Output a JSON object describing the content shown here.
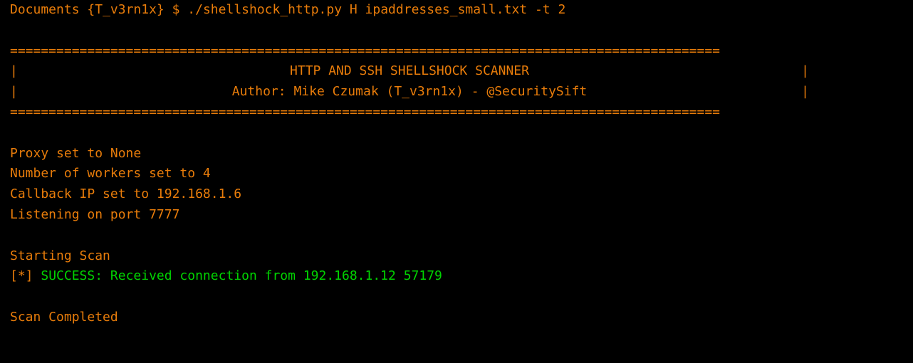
{
  "prompt": {
    "path": "Documents",
    "user": "{T_v3rn1x}",
    "symbol": "$",
    "command": "./shellshock_http.py H ipaddresses_small.txt -t 2"
  },
  "banner": {
    "border": "============================================================================================",
    "title": "HTTP AND SSH SHELLSHOCK SCANNER",
    "author": "Author: Mike Czumak (T_v3rn1x) - @SecuritySift"
  },
  "config": {
    "proxy": "Proxy set to None",
    "workers": "Number of workers set to 4",
    "callback_ip": "Callback IP set to 192.168.1.6",
    "listening": "Listening on port 7777"
  },
  "scan": {
    "starting": "Starting Scan",
    "success_marker": "[*] ",
    "success_message": "SUCCESS: Received connection from 192.168.1.12 57179",
    "completed": "Scan Completed"
  }
}
